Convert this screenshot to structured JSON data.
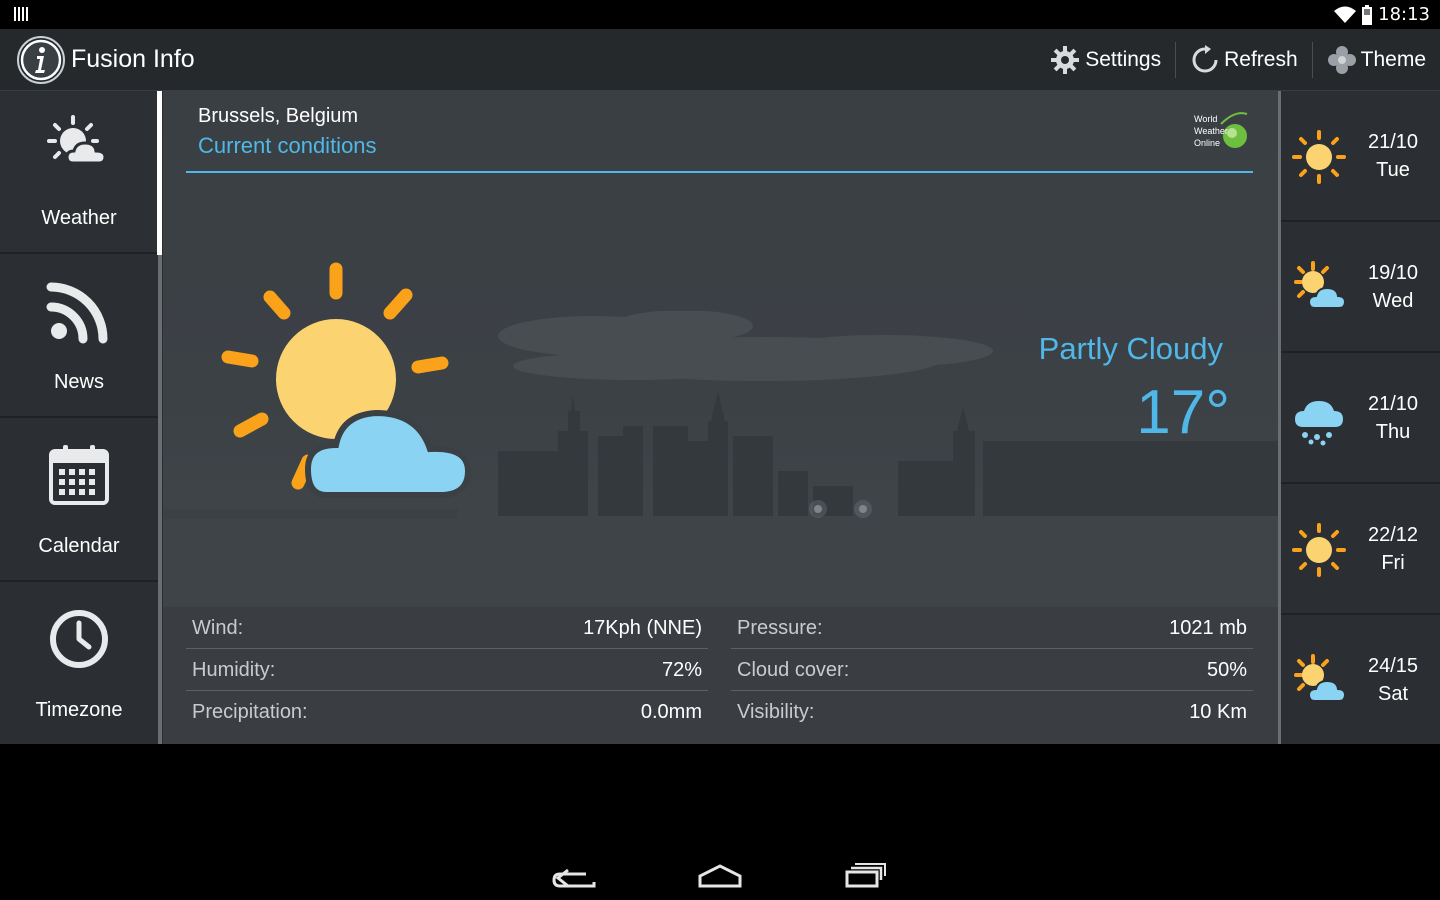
{
  "status_bar": {
    "time": "18:13"
  },
  "action_bar": {
    "title": "Fusion Info",
    "settings_label": "Settings",
    "refresh_label": "Refresh",
    "theme_label": "Theme"
  },
  "nav": {
    "items": [
      {
        "label": "Weather",
        "icon": "weather-icon"
      },
      {
        "label": "News",
        "icon": "rss-icon"
      },
      {
        "label": "Calendar",
        "icon": "calendar-icon"
      },
      {
        "label": "Timezone",
        "icon": "clock-icon"
      }
    ],
    "active": "Weather"
  },
  "current": {
    "location": "Brussels, Belgium",
    "heading": "Current conditions",
    "provider_logo_text": [
      "World",
      "Weather",
      "Online"
    ],
    "condition": "Partly Cloudy",
    "temperature": "17°",
    "icon": "partly-cloudy-icon",
    "details_left": [
      {
        "label": "Wind:",
        "value": "17Kph (NNE)"
      },
      {
        "label": "Humidity:",
        "value": "72%"
      },
      {
        "label": "Precipitation:",
        "value": "0.0mm"
      }
    ],
    "details_right": [
      {
        "label": "Pressure:",
        "value": "1021 mb"
      },
      {
        "label": "Cloud cover:",
        "value": "50%"
      },
      {
        "label": "Visibility:",
        "value": "10 Km"
      }
    ]
  },
  "forecast": [
    {
      "temps": "21/10",
      "day": "Tue",
      "icon": "sunny-icon"
    },
    {
      "temps": "19/10",
      "day": "Wed",
      "icon": "partly-cloudy-icon"
    },
    {
      "temps": "21/10",
      "day": "Thu",
      "icon": "rain-cloud-icon"
    },
    {
      "temps": "22/12",
      "day": "Fri",
      "icon": "sunny-icon"
    },
    {
      "temps": "24/15",
      "day": "Sat",
      "icon": "partly-cloudy-icon"
    }
  ],
  "colors": {
    "accent": "#4fb8e8",
    "sun": "#fbd370",
    "sun_rays": "#f9a21a",
    "cloud": "#8ad3f2",
    "panel": "#3b4045",
    "sidebar": "#2b2f33",
    "actionbar": "#26292c"
  }
}
